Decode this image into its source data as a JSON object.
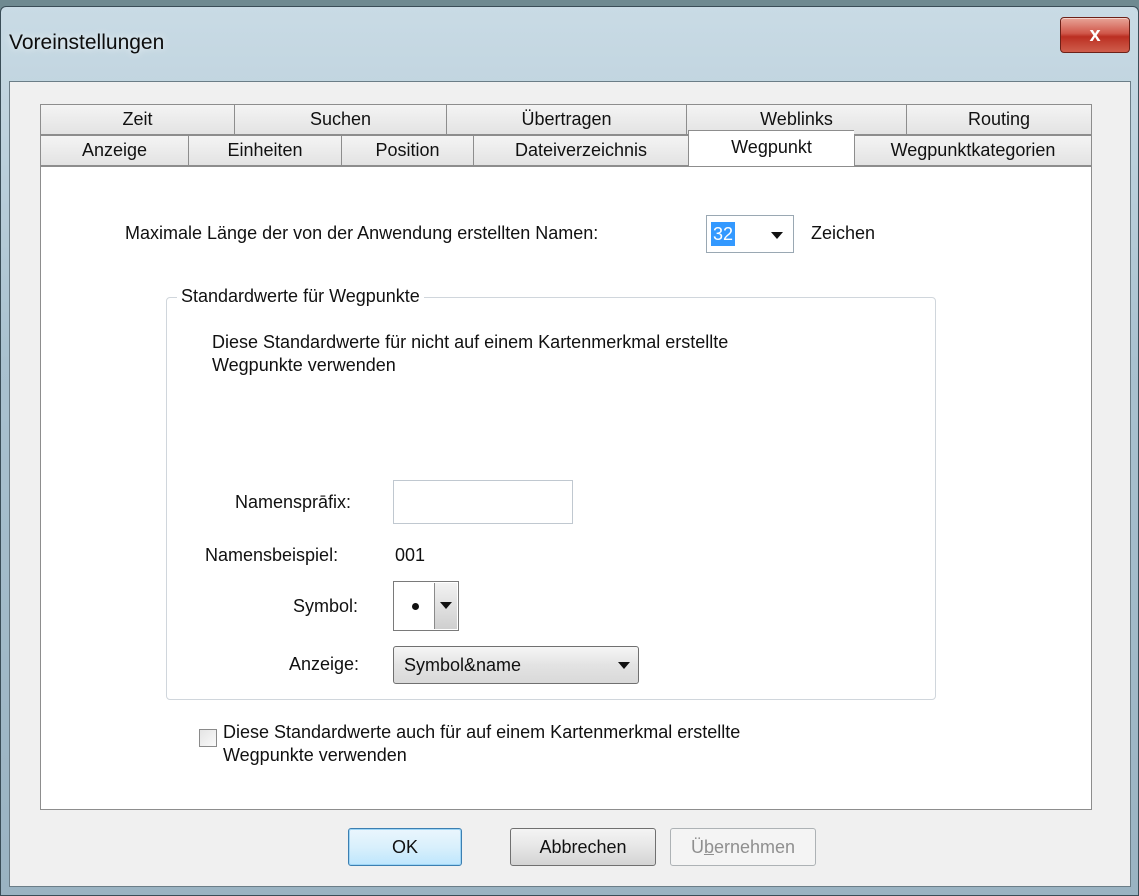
{
  "window": {
    "title": "Voreinstellungen",
    "close_glyph": "x"
  },
  "tabs_back": [
    "Zeit",
    "Suchen",
    "Übertragen",
    "Weblinks",
    "Routing"
  ],
  "tabs_front": [
    "Anzeige",
    "Einheiten",
    "Position",
    "Dateiverzeichnis",
    "Wegpunkt",
    "Wegpunktkategorien"
  ],
  "active_tab": "Wegpunkt",
  "max_length": {
    "label": "Maximale Länge der von der Anwendung erstellten Namen:",
    "value": "32",
    "unit": "Zeichen"
  },
  "group": {
    "title": "Standardwerte für Wegpunkte",
    "description_line1": "Diese Standardwerte für nicht auf einem Kartenmerkmal erstellte",
    "description_line2": "Wegpunkte verwenden",
    "prefix_label": "Namensprāfix:",
    "prefix_value": "",
    "example_label": "Namensbeispiel:",
    "example_value": "001",
    "symbol_label": "Symbol:",
    "symbol_icon": "dot-icon",
    "display_label": "Anzeige:",
    "display_value": "Symbol&name",
    "checkbox_checked": false,
    "checkbox_line1": "Diese Standardwerte auch für auf einem Kartenmerkmal erstellte",
    "checkbox_line2": "Wegpunkte verwenden"
  },
  "buttons": {
    "ok": "OK",
    "cancel": "Abbrechen",
    "apply_prefix": "Ü",
    "apply_underlined": "b",
    "apply_suffix": "ernehmen"
  }
}
